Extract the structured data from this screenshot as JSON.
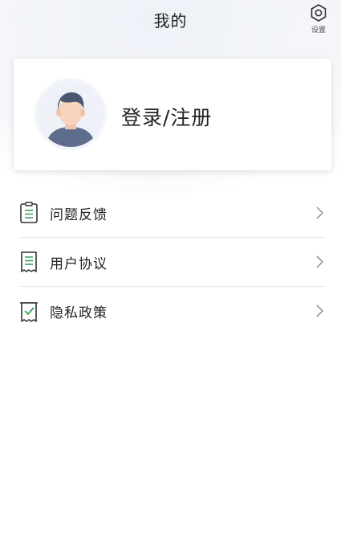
{
  "header": {
    "title": "我的",
    "settings_label": "设置"
  },
  "profile": {
    "login_label": "登录/注册"
  },
  "menu": {
    "items": [
      {
        "label": "问题反馈",
        "icon": "clipboard-icon"
      },
      {
        "label": "用户协议",
        "icon": "document-icon"
      },
      {
        "label": "隐私政策",
        "icon": "checklist-icon"
      }
    ]
  },
  "colors": {
    "accent_green": "#3aa65c",
    "icon_dark": "#333333",
    "divider": "#e6e6e6"
  }
}
